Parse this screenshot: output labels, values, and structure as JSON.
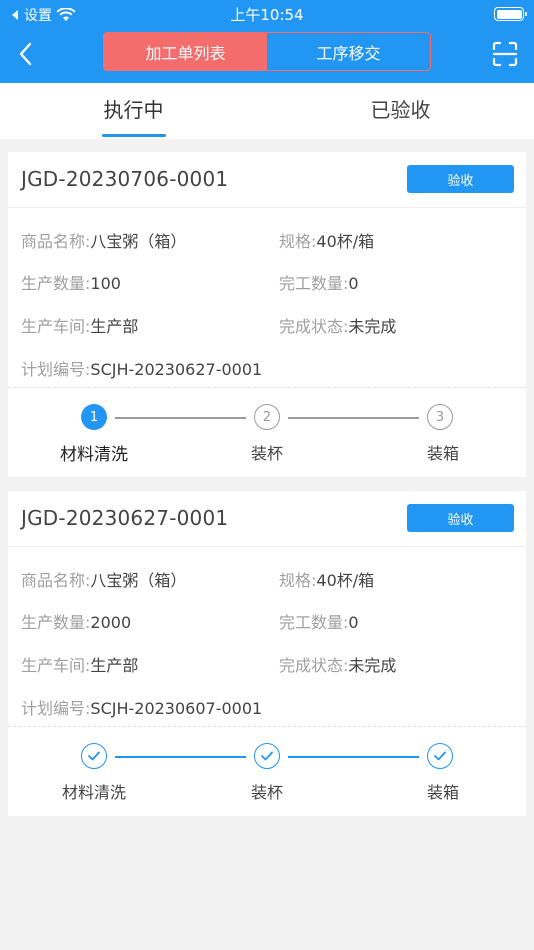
{
  "status_bar": {
    "back_app": "设置",
    "time": "上午10:54"
  },
  "nav": {
    "segments": [
      "加工单列表",
      "工序移交"
    ],
    "active_segment": 0
  },
  "tabs": [
    {
      "label": "执行中",
      "active": true
    },
    {
      "label": "已验收",
      "active": false
    }
  ],
  "labels": {
    "product_name": "商品名称:",
    "spec": "规格:",
    "produce_qty": "生产数量:",
    "finish_qty": "完工数量:",
    "workshop": "生产车间:",
    "finish_status": "完成状态:",
    "plan_no": "计划编号:"
  },
  "orders": [
    {
      "order_no": "JGD-20230706-0001",
      "accept_label": "验收",
      "product_name": "八宝粥（箱）",
      "spec": "40杯/箱",
      "produce_qty": "100",
      "finish_qty": "0",
      "workshop": "生产部",
      "finish_status": "未完成",
      "plan_no": "SCJH-20230627-0001",
      "steps": [
        {
          "num": "1",
          "label": "材料清洗",
          "state": "active"
        },
        {
          "num": "2",
          "label": "装杯",
          "state": "todo"
        },
        {
          "num": "3",
          "label": "装箱",
          "state": "todo"
        }
      ]
    },
    {
      "order_no": "JGD-20230627-0001",
      "accept_label": "验收",
      "product_name": "八宝粥（箱）",
      "spec": "40杯/箱",
      "produce_qty": "2000",
      "finish_qty": "0",
      "workshop": "生产部",
      "finish_status": "未完成",
      "plan_no": "SCJH-20230607-0001",
      "steps": [
        {
          "num": "",
          "label": "材料清洗",
          "state": "done"
        },
        {
          "num": "",
          "label": "装杯",
          "state": "done"
        },
        {
          "num": "",
          "label": "装箱",
          "state": "done"
        }
      ]
    }
  ],
  "colors": {
    "primary": "#2196f3",
    "segment_active": "#f36d6d",
    "background": "#f2f2f2",
    "muted_label": "#a0a0a0"
  }
}
